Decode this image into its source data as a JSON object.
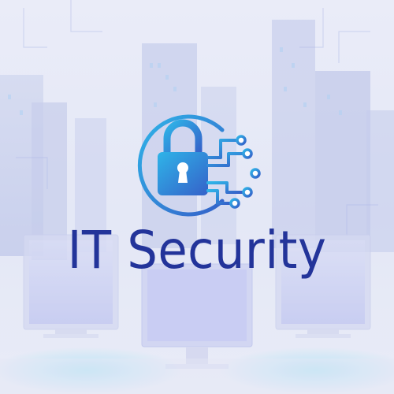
{
  "brand": {
    "title": "IT Security",
    "title_color": "#23349a",
    "emblem_icon": "padlock-circuit-icon",
    "emblem_gradient": [
      "#2fb4e8",
      "#3561c9"
    ]
  },
  "background": {
    "scene": "city-skyline-with-monitors",
    "tint": "#e2e6f5",
    "glow_colors": [
      "#4fd2f0",
      "#6b78d8",
      "#8a90e6"
    ]
  }
}
